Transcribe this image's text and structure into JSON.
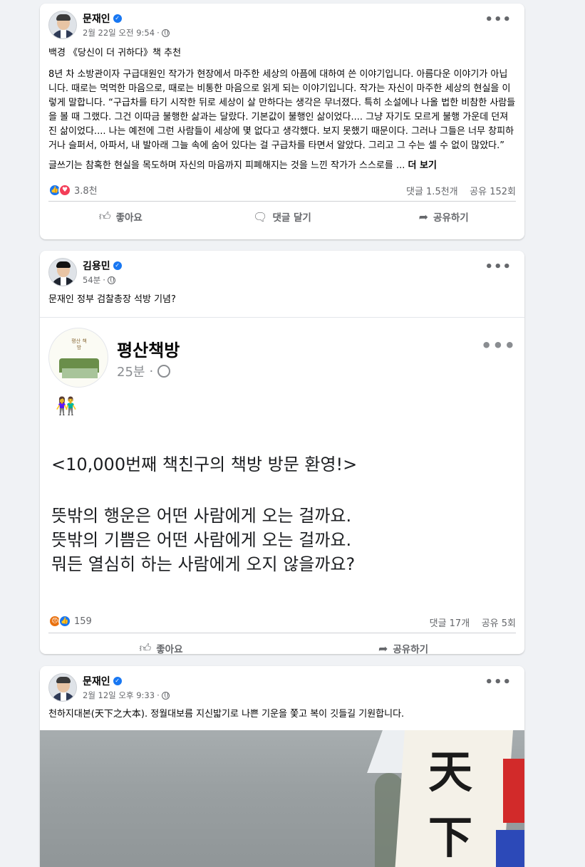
{
  "posts": [
    {
      "author": "문재인",
      "time": "2월 22일 오전 9:54",
      "title": "백경 《당신이 더 귀하다》책 추천",
      "body": "8년 차 소방관이자 구급대원인 작가가 현장에서 마주한 세상의 아픔에 대하여 쓴 이야기입니다. 아름다운 이야기가 아닙니다. 때로는 먹먹한 마음으로, 때로는 비통한 마음으로 읽게 되는 이야기입니다. 작가는 자신이 마주한 세상의 현실을 이렇게 말합니다. “구급차를 타기 시작한 뒤로 세상이 살 만하다는 생각은 무너졌다. 특히 소설에나 나올 법한 비참한 사람들을 볼 때 그랬다. 그건 이따금 불행한 삶과는 달랐다. 기본값이 불행인 삶이었다.... 그냥 자기도 모르게 불행 가운데 던져진 삶이었다.... 나는 예전에 그런 사람들이 세상에 몇 없다고 생각했다. 보지 못했기 때문이다. 그러나 그들은 너무 창피하거나 슬퍼서, 아파서, 내 발아래 그늘 속에 숨어 있다는 걸 구급차를 타면서 알았다. 그리고 그 수는 셀 수 없이 많았다.”",
      "body2": "글쓰기는 참혹한 현실을 목도하며 자신의 마음까지 피폐해지는 것을 느낀 작가가 스스로를 ...",
      "see_more": "더 보기",
      "reaction_count": "3.8천",
      "comments": "댓글 1.5천개",
      "shares": "공유 152회",
      "like_label": "좋아요",
      "comment_label": "댓글 달기",
      "share_label": "공유하기"
    },
    {
      "author": "김용민",
      "time": "54분",
      "text": "문재인 정부 검찰총장 석방 기념?",
      "shared": {
        "author": "평산책방",
        "avatar_text": "평산 책방",
        "time": "25분",
        "emoji": "👫",
        "line1": "<10,000번째 책친구의 책방 방문 환영!>",
        "line2": "뜻밖의 행운은 어떤 사람에게 오는 걸까요.",
        "line3": "뜻밖의 기쁨은 어떤 사람에게 오는 걸까요.",
        "line4": "뭐든 열심히 하는 사람에게 오지 않을까요?"
      },
      "reaction_count": "159",
      "comments": "댓글 17개",
      "shares": "공유 5회",
      "like_label": "좋아요",
      "share_label": "공유하기"
    },
    {
      "author": "문재인",
      "time": "2월 12일 오후 9:33",
      "text": "천하지대본(天下之大本). 정월대보름 지신밟기로 나쁜 기운을 쫓고 복이 깃들길 기원합니다.",
      "banner_chars": [
        "天",
        "下"
      ]
    }
  ],
  "icons": {
    "verified": "verified-badge-icon",
    "globe": "globe-icon",
    "more": "more-options-icon",
    "like": "thumbs-up-icon",
    "comment": "comment-icon",
    "share": "share-icon"
  },
  "colors": {
    "accent": "#1877f2",
    "love": "#f33e58",
    "angry": "#e9710f",
    "background": "#f0f2f5"
  }
}
